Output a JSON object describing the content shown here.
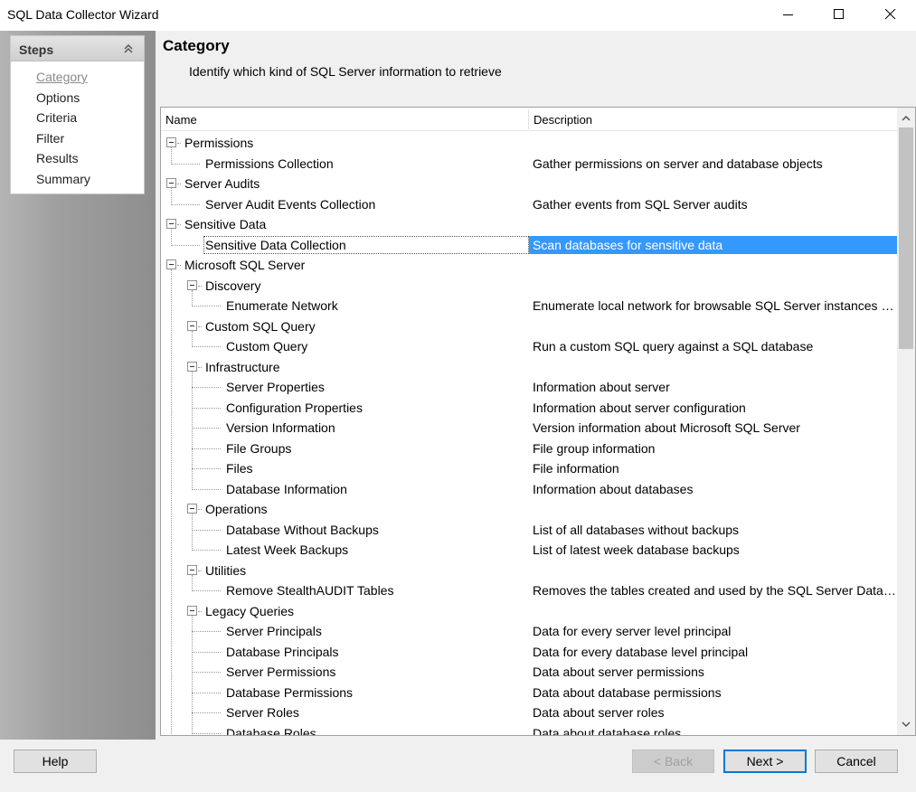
{
  "window": {
    "title": "SQL Data Collector Wizard"
  },
  "steps": {
    "header": "Steps",
    "items": [
      "Category",
      "Options",
      "Criteria",
      "Filter",
      "Results",
      "Summary"
    ],
    "active": "Category"
  },
  "page": {
    "title": "Category",
    "subtitle": "Identify which kind of SQL Server information to retrieve"
  },
  "tree": {
    "columns": {
      "name": "Name",
      "description": "Description"
    },
    "rows": [
      {
        "name": "Permissions",
        "desc": ""
      },
      {
        "name": "Permissions Collection",
        "desc": "Gather permissions on server and database objects"
      },
      {
        "name": "Server Audits",
        "desc": ""
      },
      {
        "name": "Server Audit Events Collection",
        "desc": "Gather events from SQL Server audits"
      },
      {
        "name": "Sensitive Data",
        "desc": ""
      },
      {
        "name": "Sensitive Data Collection",
        "desc": "Scan databases for sensitive data"
      },
      {
        "name": "Microsoft SQL Server",
        "desc": ""
      },
      {
        "name": "Discovery",
        "desc": ""
      },
      {
        "name": "Enumerate Network",
        "desc": "Enumerate local network for browsable SQL Server instances vis..."
      },
      {
        "name": "Custom SQL Query",
        "desc": ""
      },
      {
        "name": "Custom Query",
        "desc": "Run a custom SQL query against a SQL database"
      },
      {
        "name": "Infrastructure",
        "desc": ""
      },
      {
        "name": "Server Properties",
        "desc": "Information about server"
      },
      {
        "name": "Configuration Properties",
        "desc": "Information about server configuration"
      },
      {
        "name": "Version Information",
        "desc": "Version information about Microsoft SQL Server"
      },
      {
        "name": "File Groups",
        "desc": "File group information"
      },
      {
        "name": "Files",
        "desc": "File information"
      },
      {
        "name": "Database Information",
        "desc": "Information about databases"
      },
      {
        "name": "Operations",
        "desc": ""
      },
      {
        "name": "Database Without Backups",
        "desc": "List of all databases without backups"
      },
      {
        "name": "Latest Week Backups",
        "desc": "List of latest week database backups"
      },
      {
        "name": "Utilities",
        "desc": ""
      },
      {
        "name": "Remove StealthAUDIT Tables",
        "desc": "Removes the tables created and used by the SQL Server Data ..."
      },
      {
        "name": "Legacy Queries",
        "desc": ""
      },
      {
        "name": "Server Principals",
        "desc": "Data for every server level principal"
      },
      {
        "name": "Database Principals",
        "desc": "Data for every database level principal"
      },
      {
        "name": "Server Permissions",
        "desc": "Data about server permissions"
      },
      {
        "name": "Database Permissions",
        "desc": "Data about database permissions"
      },
      {
        "name": "Server Roles",
        "desc": "Data about server roles"
      },
      {
        "name": "Database Roles",
        "desc": "Data about database roles"
      }
    ]
  },
  "buttons": {
    "help": "Help",
    "back": "< Back",
    "next": "Next >",
    "cancel": "Cancel"
  }
}
